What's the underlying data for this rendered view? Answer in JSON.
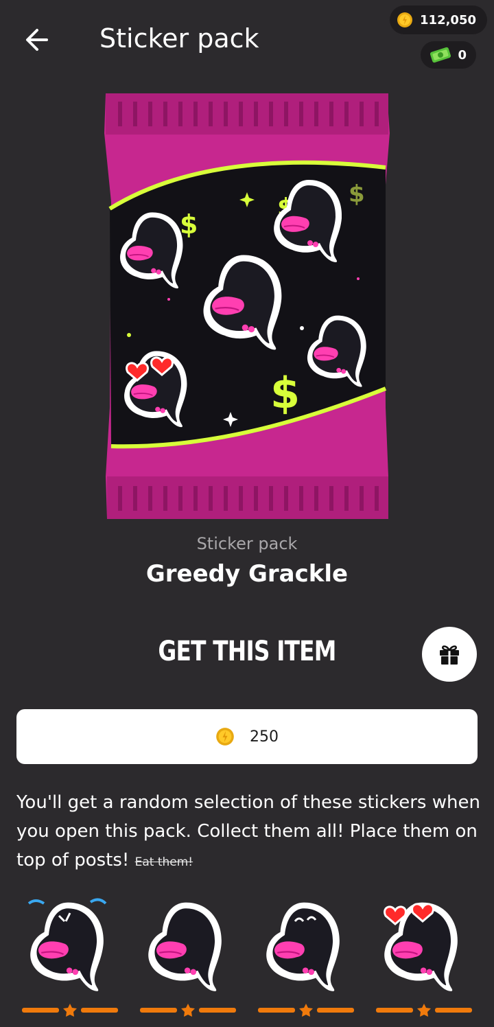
{
  "header": {
    "title": "Sticker pack",
    "back_icon": "arrow-left-icon"
  },
  "balances": {
    "coins": "112,050",
    "cash": "0",
    "coin_icon": "coin-icon",
    "cash_icon": "cash-icon"
  },
  "item": {
    "kind": "Sticker pack",
    "name": "Greedy Grackle"
  },
  "purchase": {
    "title": "GET THIS ITEM",
    "price": "250",
    "gift_icon": "gift-icon"
  },
  "description": {
    "text": "You'll get a random selection of these stickers when you open this pack. Collect them all! Place them on top of posts!",
    "struck_text": "Eat them!"
  },
  "stickers": [
    {
      "name": "crying-grackle"
    },
    {
      "name": "plain-grackle"
    },
    {
      "name": "happy-grackle"
    },
    {
      "name": "heart-eyes-grackle"
    }
  ],
  "colors": {
    "background": "#2c2a2d",
    "pack_pink": "#c7278f",
    "accent_lime": "#d8ff3a",
    "rarity_orange": "#f07a0c",
    "beak_pink": "#ff3fb1"
  }
}
